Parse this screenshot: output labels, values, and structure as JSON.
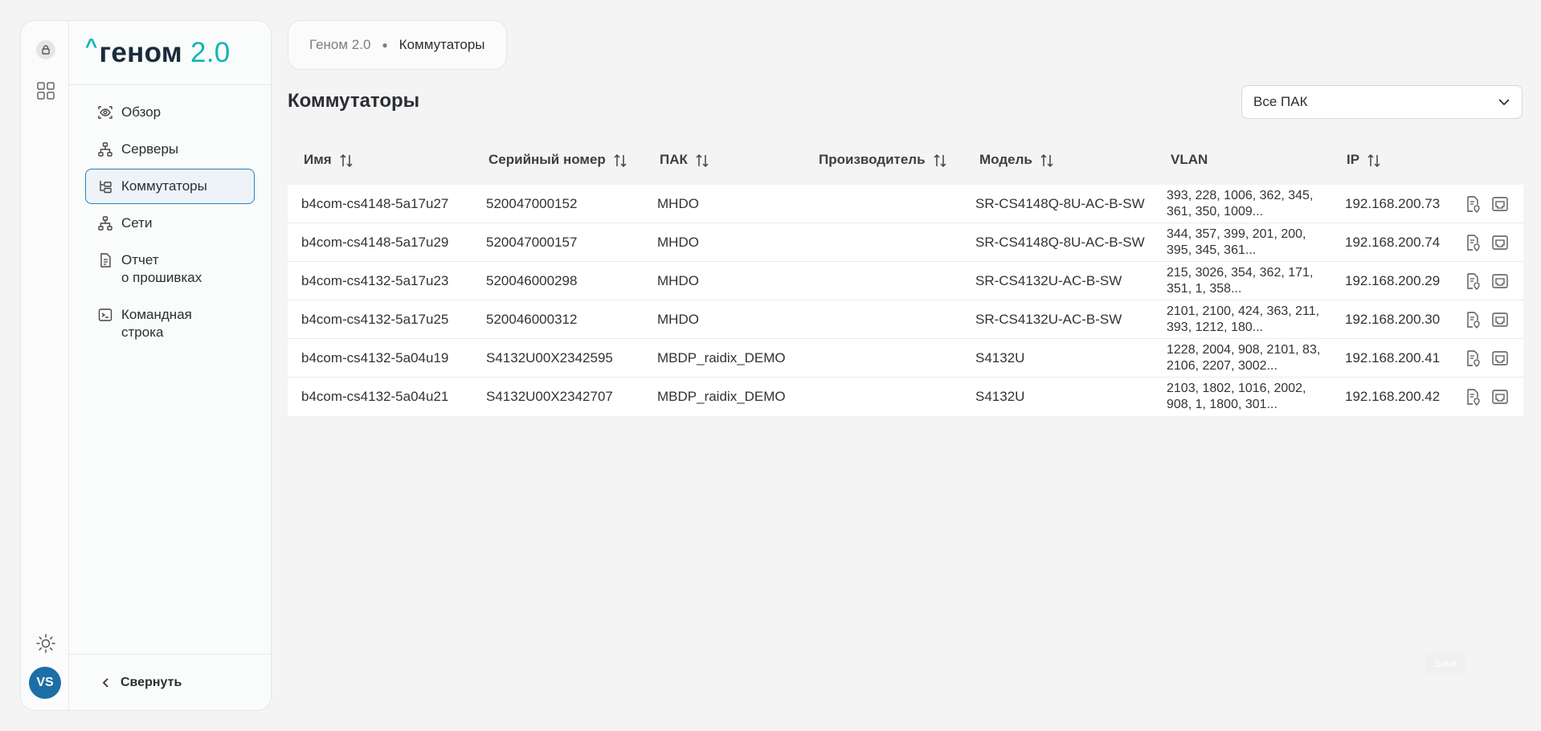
{
  "logo": {
    "caret": "^",
    "name": "геном",
    "version": "2.0"
  },
  "rail": {
    "avatar": "VS"
  },
  "nav": [
    {
      "id": "overview",
      "line1": "Обзор",
      "line2": "",
      "icon": "eye-scan-icon"
    },
    {
      "id": "servers",
      "line1": "Серверы",
      "line2": "",
      "icon": "hierarchy-icon"
    },
    {
      "id": "switches",
      "line1": "Коммутаторы",
      "line2": "",
      "icon": "tree-icon",
      "active": true
    },
    {
      "id": "networks",
      "line1": "Сети",
      "line2": "",
      "icon": "hierarchy-icon"
    },
    {
      "id": "firmware-report",
      "line1": "Отчет",
      "line2": "о прошивках",
      "icon": "document-icon"
    },
    {
      "id": "cli",
      "line1": "Командная",
      "line2": "строка",
      "icon": "terminal-icon"
    }
  ],
  "collapse_label": "Свернуть",
  "breadcrumb": {
    "root": "Геном 2.0",
    "current": "Коммутаторы"
  },
  "page_title": "Коммутаторы",
  "filter": {
    "selected": "Все ПАК"
  },
  "table": {
    "headers": {
      "name": "Имя",
      "serial": "Серийный номер",
      "pak": "ПАК",
      "manufacturer": "Производитель",
      "model": "Модель",
      "vlan": "VLAN",
      "ip": "IP"
    },
    "rows": [
      {
        "name": "b4com-cs4148-5a17u27",
        "serial": "520047000152",
        "pak": "MHDO",
        "manufacturer": "",
        "model": "SR-CS4148Q-8U-AC-B-SW",
        "vlan": "393, 228, 1006, 362, 345, 361, 350, 1009...",
        "ip": "192.168.200.73"
      },
      {
        "name": "b4com-cs4148-5a17u29",
        "serial": "520047000157",
        "pak": "MHDO",
        "manufacturer": "",
        "model": "SR-CS4148Q-8U-AC-B-SW",
        "vlan": "344, 357, 399, 201, 200, 395, 345, 361...",
        "ip": "192.168.200.74"
      },
      {
        "name": "b4com-cs4132-5a17u23",
        "serial": "520046000298",
        "pak": "MHDO",
        "manufacturer": "",
        "model": "SR-CS4132U-AC-B-SW",
        "vlan": "215, 3026, 354, 362, 171, 351, 1, 358...",
        "ip": "192.168.200.29"
      },
      {
        "name": "b4com-cs4132-5a17u25",
        "serial": "520046000312",
        "pak": "MHDO",
        "manufacturer": "",
        "model": "SR-CS4132U-AC-B-SW",
        "vlan": "2101, 2100, 424, 363, 211, 393, 1212, 180...",
        "ip": "192.168.200.30"
      },
      {
        "name": "b4com-cs4132-5a04u19",
        "serial": "S4132U00X2342595",
        "pak": "MBDP_raidix_DEMO",
        "manufacturer": "",
        "model": "S4132U",
        "vlan": "1228, 2004, 908, 2101, 83, 2106, 2207, 3002...",
        "ip": "192.168.200.41"
      },
      {
        "name": "b4com-cs4132-5a04u21",
        "serial": "S4132U00X2342707",
        "pak": "MBDP_raidix_DEMO",
        "manufacturer": "",
        "model": "S4132U",
        "vlan": "2103, 1802, 1016, 2002, 908, 1, 1800, 301...",
        "ip": "192.168.200.42"
      }
    ]
  },
  "save_label": "Save",
  "colors": {
    "accent": "#12b3b8",
    "brand_dark": "#1b2a3c",
    "active_border": "#2c7fb8",
    "avatar": "#1c6fa6"
  }
}
